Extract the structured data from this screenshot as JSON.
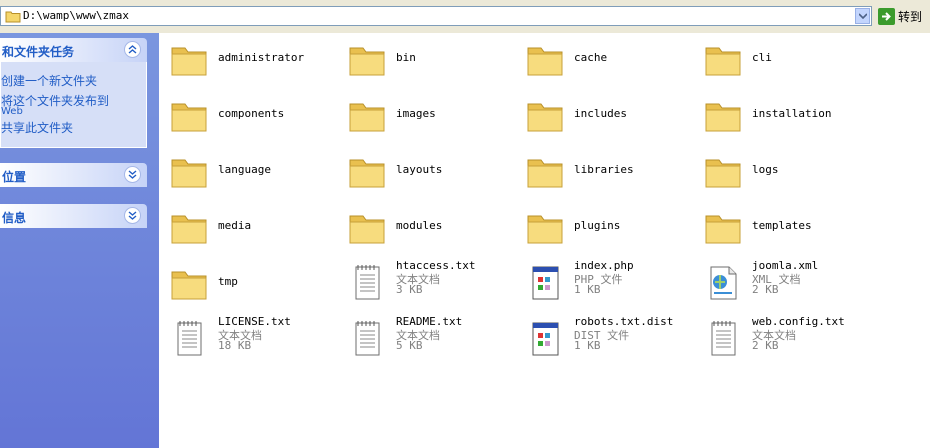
{
  "address": {
    "path": "D:\\wamp\\www\\zmax",
    "go_label": "转到"
  },
  "tasks": {
    "file_folder_tasks": {
      "title": "和文件夹任务",
      "items": [
        "创建一个新文件夹",
        "将这个文件夹发布到",
        "Web",
        "共享此文件夹"
      ]
    },
    "other_places": {
      "title": "位置"
    },
    "details": {
      "title": "信息"
    }
  },
  "folders": [
    "administrator",
    "bin",
    "cache",
    "cli",
    "components",
    "images",
    "includes",
    "installation",
    "language",
    "layouts",
    "libraries",
    "logs",
    "media",
    "modules",
    "plugins",
    "templates",
    "tmp"
  ],
  "files": [
    {
      "name": "htaccess.txt",
      "type": "文本文档",
      "size": "3 KB",
      "icon": "text-document-icon"
    },
    {
      "name": "index.php",
      "type": "PHP 文件",
      "size": "1 KB",
      "icon": "php-file-icon"
    },
    {
      "name": "joomla.xml",
      "type": "XML 文档",
      "size": "2 KB",
      "icon": "xml-document-icon"
    },
    {
      "name": "LICENSE.txt",
      "type": "文本文档",
      "size": "18 KB",
      "icon": "text-document-icon"
    },
    {
      "name": "README.txt",
      "type": "文本文档",
      "size": "5 KB",
      "icon": "text-document-icon"
    },
    {
      "name": "robots.txt.dist",
      "type": "DIST 文件",
      "size": "1 KB",
      "icon": "dist-file-icon"
    },
    {
      "name": "web.config.txt",
      "type": "文本文档",
      "size": "2 KB",
      "icon": "text-document-icon"
    }
  ],
  "colors": {
    "task_link": "#215dc6",
    "pane_bg": "#6f88db",
    "folder": "#f5d66b"
  }
}
